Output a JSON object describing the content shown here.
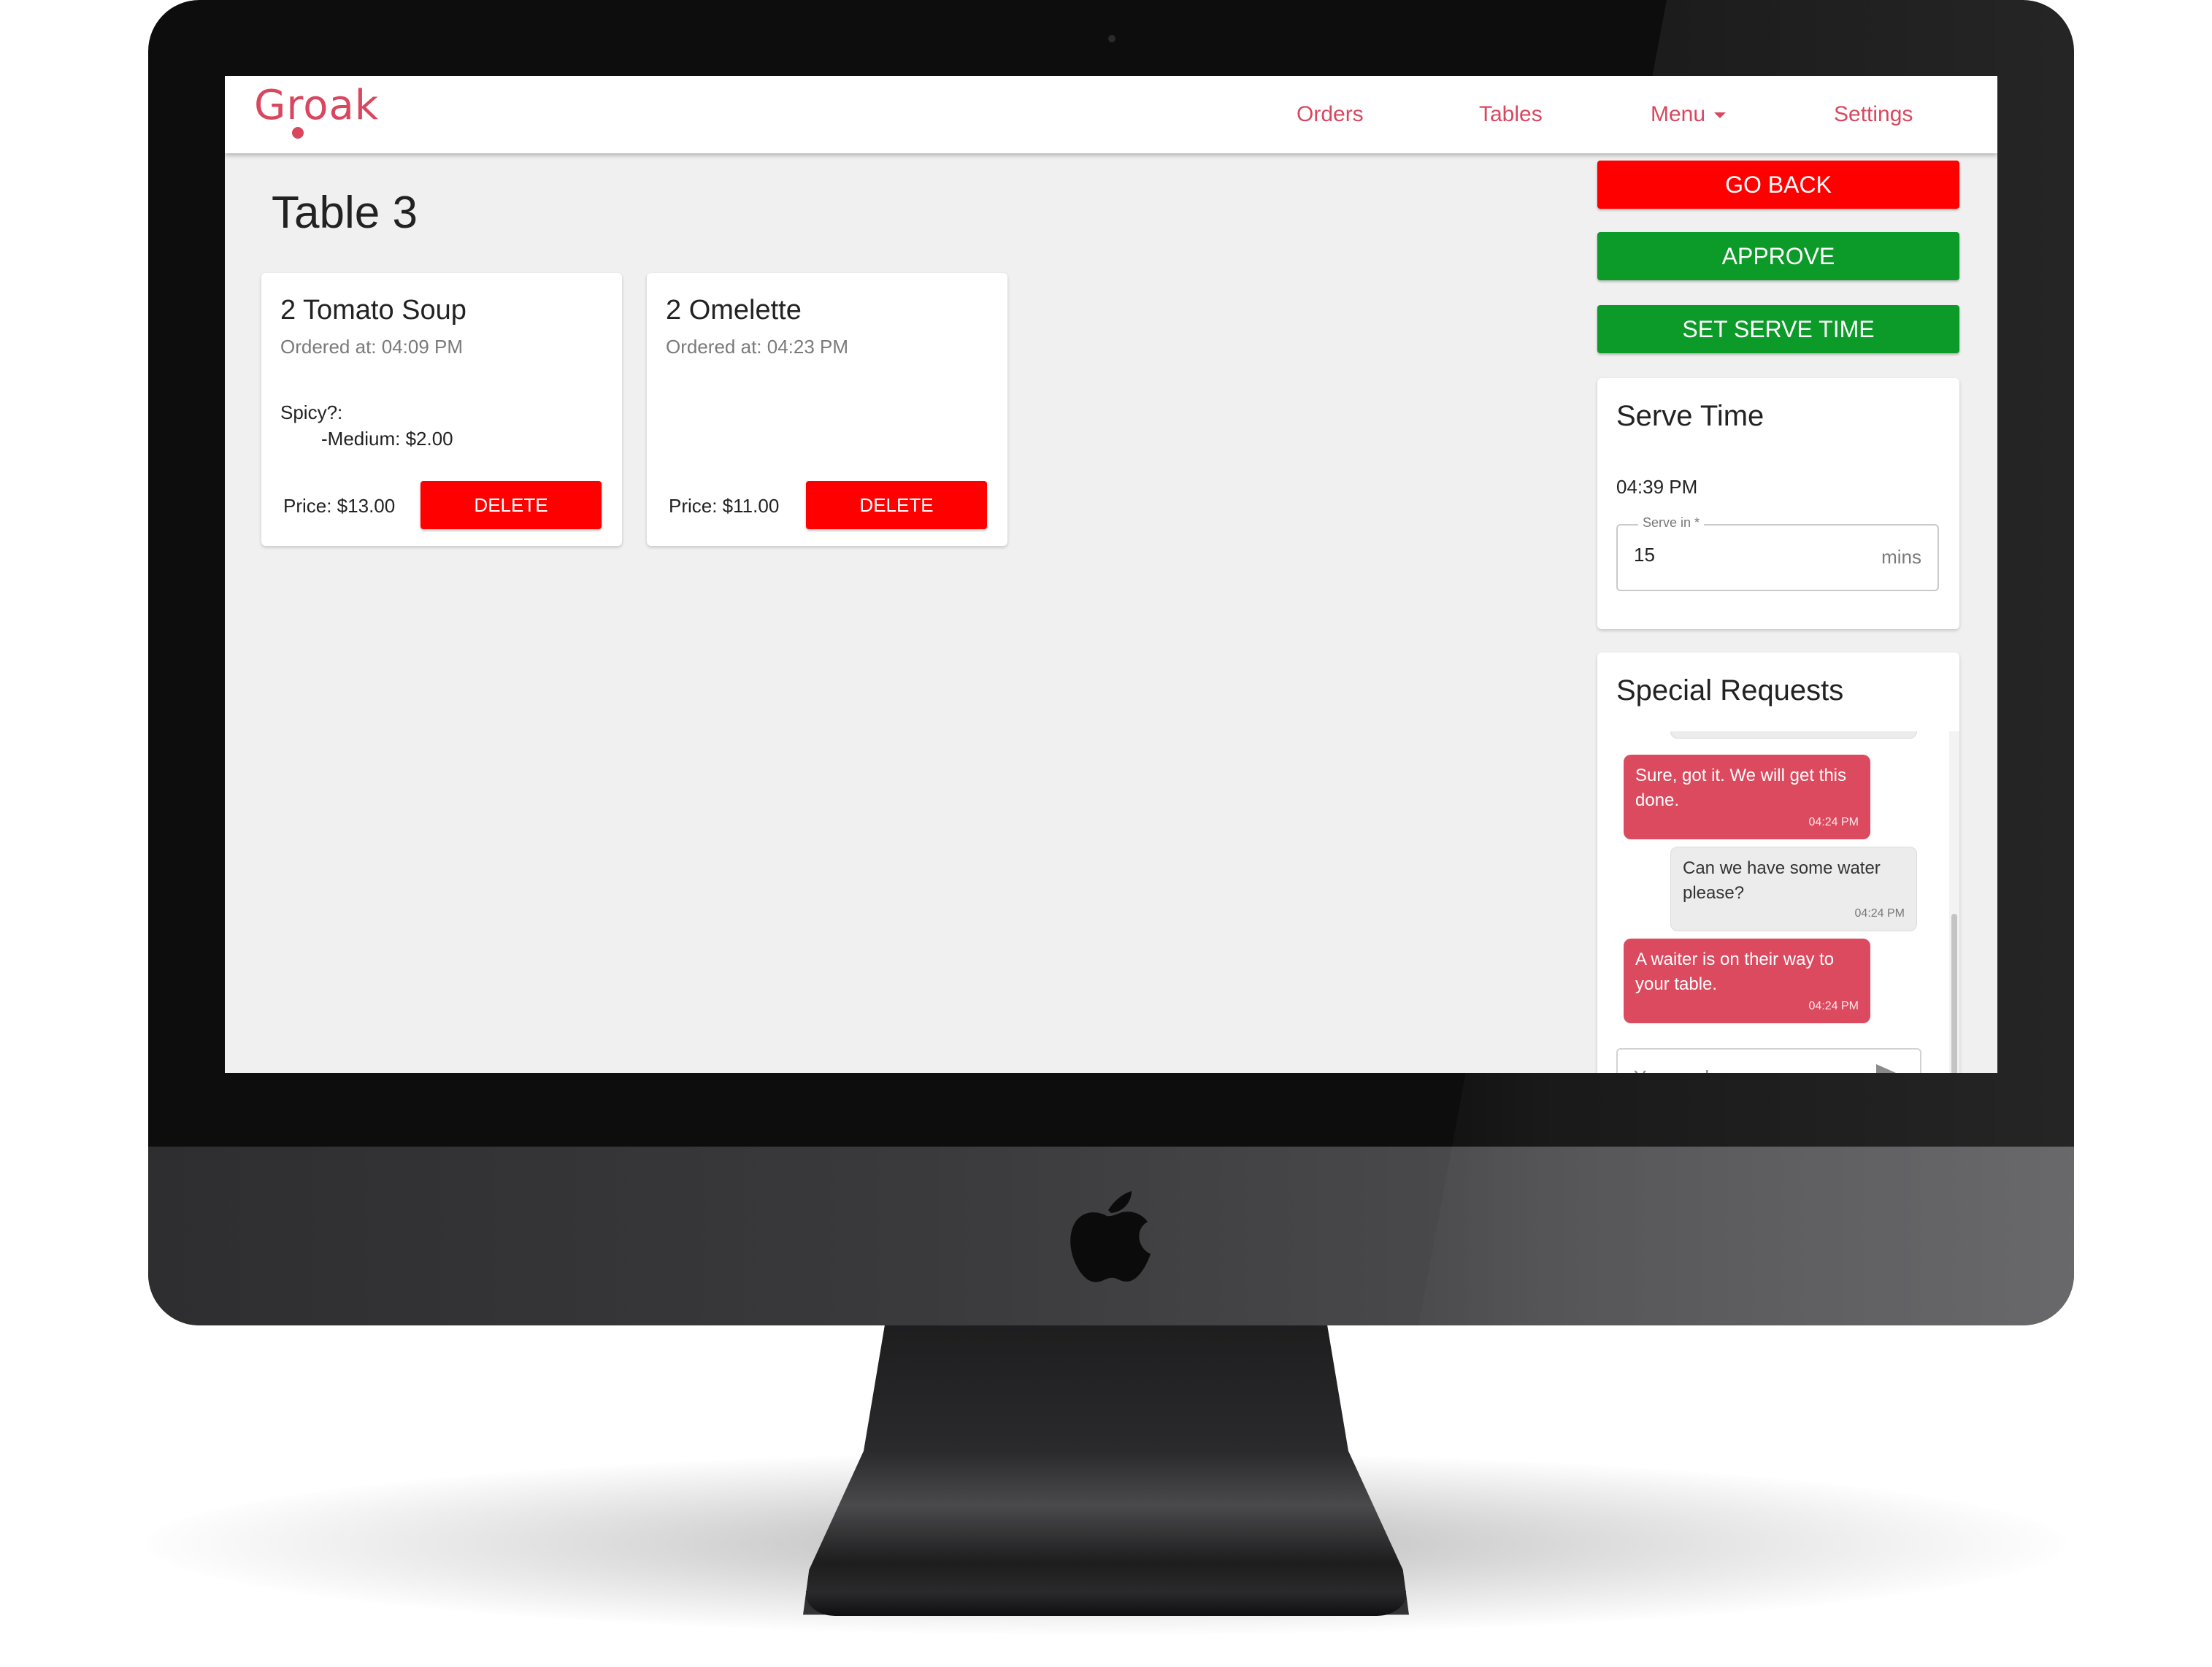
{
  "app": {
    "logo_text": "Groak",
    "brand_color": "#d9475f"
  },
  "nav": {
    "orders": "Orders",
    "tables": "Tables",
    "menu": "Menu",
    "settings": "Settings"
  },
  "page": {
    "title": "Table 3"
  },
  "orders": [
    {
      "title": "2 Tomato Soup",
      "ordered_at": "Ordered at: 04:09 PM",
      "option_label": "Spicy?:",
      "option_value": "-Medium: $2.00",
      "price": "Price: $13.00",
      "delete_label": "DELETE"
    },
    {
      "title": "2 Omelette",
      "ordered_at": "Ordered at: 04:23 PM",
      "option_label": "",
      "option_value": "",
      "price": "Price: $11.00",
      "delete_label": "DELETE"
    }
  ],
  "actions": {
    "go_back": "GO BACK",
    "approve": "APPROVE",
    "set_serve_time": "SET SERVE TIME",
    "colors": {
      "danger": "#ff0000",
      "success": "#0c9a28"
    }
  },
  "serve_time": {
    "heading": "Serve Time",
    "time": "04:39 PM",
    "field_label": "Serve in *",
    "value": "15",
    "suffix": "mins"
  },
  "special_requests": {
    "heading": "Special Requests",
    "messages": [
      {
        "text": "Sure, got it. We will get this done.",
        "time": "04:24 PM",
        "from": "restaurant"
      },
      {
        "text": "Can we have some water please?",
        "time": "04:24 PM",
        "from": "customer"
      },
      {
        "text": "A waiter is on their way to your table.",
        "time": "04:24 PM",
        "from": "restaurant"
      }
    ],
    "reply_placeholder": "Your reply",
    "send_icon": "send-icon"
  }
}
